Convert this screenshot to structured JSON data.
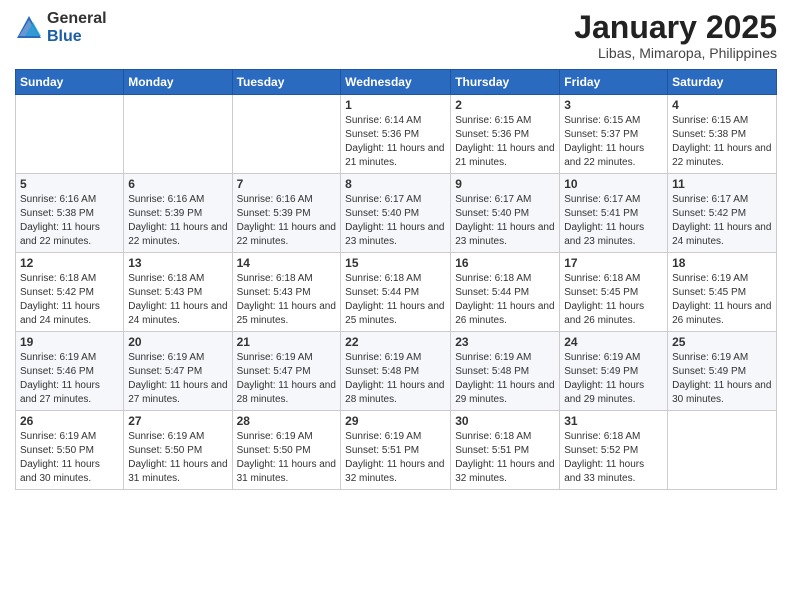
{
  "logo": {
    "general": "General",
    "blue": "Blue"
  },
  "title": {
    "month": "January 2025",
    "location": "Libas, Mimaropa, Philippines"
  },
  "days_of_week": [
    "Sunday",
    "Monday",
    "Tuesday",
    "Wednesday",
    "Thursday",
    "Friday",
    "Saturday"
  ],
  "weeks": [
    [
      {
        "day": "",
        "info": ""
      },
      {
        "day": "",
        "info": ""
      },
      {
        "day": "",
        "info": ""
      },
      {
        "day": "1",
        "info": "Sunrise: 6:14 AM\nSunset: 5:36 PM\nDaylight: 11 hours and 21 minutes."
      },
      {
        "day": "2",
        "info": "Sunrise: 6:15 AM\nSunset: 5:36 PM\nDaylight: 11 hours and 21 minutes."
      },
      {
        "day": "3",
        "info": "Sunrise: 6:15 AM\nSunset: 5:37 PM\nDaylight: 11 hours and 22 minutes."
      },
      {
        "day": "4",
        "info": "Sunrise: 6:15 AM\nSunset: 5:38 PM\nDaylight: 11 hours and 22 minutes."
      }
    ],
    [
      {
        "day": "5",
        "info": "Sunrise: 6:16 AM\nSunset: 5:38 PM\nDaylight: 11 hours and 22 minutes."
      },
      {
        "day": "6",
        "info": "Sunrise: 6:16 AM\nSunset: 5:39 PM\nDaylight: 11 hours and 22 minutes."
      },
      {
        "day": "7",
        "info": "Sunrise: 6:16 AM\nSunset: 5:39 PM\nDaylight: 11 hours and 22 minutes."
      },
      {
        "day": "8",
        "info": "Sunrise: 6:17 AM\nSunset: 5:40 PM\nDaylight: 11 hours and 23 minutes."
      },
      {
        "day": "9",
        "info": "Sunrise: 6:17 AM\nSunset: 5:40 PM\nDaylight: 11 hours and 23 minutes."
      },
      {
        "day": "10",
        "info": "Sunrise: 6:17 AM\nSunset: 5:41 PM\nDaylight: 11 hours and 23 minutes."
      },
      {
        "day": "11",
        "info": "Sunrise: 6:17 AM\nSunset: 5:42 PM\nDaylight: 11 hours and 24 minutes."
      }
    ],
    [
      {
        "day": "12",
        "info": "Sunrise: 6:18 AM\nSunset: 5:42 PM\nDaylight: 11 hours and 24 minutes."
      },
      {
        "day": "13",
        "info": "Sunrise: 6:18 AM\nSunset: 5:43 PM\nDaylight: 11 hours and 24 minutes."
      },
      {
        "day": "14",
        "info": "Sunrise: 6:18 AM\nSunset: 5:43 PM\nDaylight: 11 hours and 25 minutes."
      },
      {
        "day": "15",
        "info": "Sunrise: 6:18 AM\nSunset: 5:44 PM\nDaylight: 11 hours and 25 minutes."
      },
      {
        "day": "16",
        "info": "Sunrise: 6:18 AM\nSunset: 5:44 PM\nDaylight: 11 hours and 26 minutes."
      },
      {
        "day": "17",
        "info": "Sunrise: 6:18 AM\nSunset: 5:45 PM\nDaylight: 11 hours and 26 minutes."
      },
      {
        "day": "18",
        "info": "Sunrise: 6:19 AM\nSunset: 5:45 PM\nDaylight: 11 hours and 26 minutes."
      }
    ],
    [
      {
        "day": "19",
        "info": "Sunrise: 6:19 AM\nSunset: 5:46 PM\nDaylight: 11 hours and 27 minutes."
      },
      {
        "day": "20",
        "info": "Sunrise: 6:19 AM\nSunset: 5:47 PM\nDaylight: 11 hours and 27 minutes."
      },
      {
        "day": "21",
        "info": "Sunrise: 6:19 AM\nSunset: 5:47 PM\nDaylight: 11 hours and 28 minutes."
      },
      {
        "day": "22",
        "info": "Sunrise: 6:19 AM\nSunset: 5:48 PM\nDaylight: 11 hours and 28 minutes."
      },
      {
        "day": "23",
        "info": "Sunrise: 6:19 AM\nSunset: 5:48 PM\nDaylight: 11 hours and 29 minutes."
      },
      {
        "day": "24",
        "info": "Sunrise: 6:19 AM\nSunset: 5:49 PM\nDaylight: 11 hours and 29 minutes."
      },
      {
        "day": "25",
        "info": "Sunrise: 6:19 AM\nSunset: 5:49 PM\nDaylight: 11 hours and 30 minutes."
      }
    ],
    [
      {
        "day": "26",
        "info": "Sunrise: 6:19 AM\nSunset: 5:50 PM\nDaylight: 11 hours and 30 minutes."
      },
      {
        "day": "27",
        "info": "Sunrise: 6:19 AM\nSunset: 5:50 PM\nDaylight: 11 hours and 31 minutes."
      },
      {
        "day": "28",
        "info": "Sunrise: 6:19 AM\nSunset: 5:50 PM\nDaylight: 11 hours and 31 minutes."
      },
      {
        "day": "29",
        "info": "Sunrise: 6:19 AM\nSunset: 5:51 PM\nDaylight: 11 hours and 32 minutes."
      },
      {
        "day": "30",
        "info": "Sunrise: 6:18 AM\nSunset: 5:51 PM\nDaylight: 11 hours and 32 minutes."
      },
      {
        "day": "31",
        "info": "Sunrise: 6:18 AM\nSunset: 5:52 PM\nDaylight: 11 hours and 33 minutes."
      },
      {
        "day": "",
        "info": ""
      }
    ]
  ]
}
